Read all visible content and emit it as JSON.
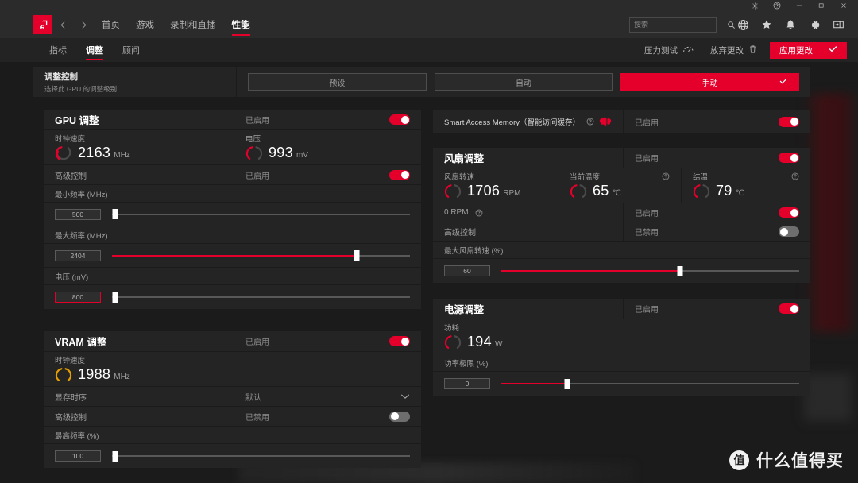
{
  "window": {
    "controls": [
      "settings-icon",
      "help-icon",
      "minimize-icon",
      "maximize-icon",
      "close-icon"
    ]
  },
  "nav": {
    "logo_alt": "AMD",
    "back": "←",
    "forward": "→",
    "items": [
      {
        "label": "首页",
        "active": false
      },
      {
        "label": "游戏",
        "active": false
      },
      {
        "label": "录制和直播",
        "active": false
      },
      {
        "label": "性能",
        "active": true
      }
    ],
    "search": {
      "value": "",
      "placeholder": "搜索"
    },
    "icons": [
      "globe-icon",
      "star-icon",
      "bell-icon",
      "gear-icon",
      "panel-icon"
    ]
  },
  "subnav": {
    "tabs": [
      {
        "label": "指标",
        "active": false
      },
      {
        "label": "调整",
        "active": true
      },
      {
        "label": "顾问",
        "active": false
      }
    ],
    "stress_test": "压力测试",
    "discard": "放弃更改",
    "apply": "应用更改"
  },
  "tuning_control": {
    "title": "调整控制",
    "subtitle": "选择此 GPU 的调整级别",
    "presets": [
      {
        "label": "预设",
        "selected": false
      },
      {
        "label": "自动",
        "selected": false
      },
      {
        "label": "手动",
        "selected": true
      }
    ]
  },
  "gpu_tuning": {
    "title": "GPU 调整",
    "enabled_label": "已启用",
    "enabled": true,
    "clock_speed": {
      "label": "时钟速度",
      "value": "2163",
      "unit": "MHz"
    },
    "voltage": {
      "label": "电压",
      "value": "993",
      "unit": "mV"
    },
    "advanced_control": {
      "label": "高级控制",
      "state": "已启用",
      "on": true
    },
    "min_freq": {
      "label": "最小频率 (MHz)",
      "value": "500",
      "percent": 1,
      "filled": 0,
      "alert": false
    },
    "max_freq": {
      "label": "最大频率 (MHz)",
      "value": "2404",
      "percent": 82,
      "filled": 82,
      "alert": false
    },
    "voltage_slider": {
      "label": "电压 (mV)",
      "value": "800",
      "percent": 1,
      "filled": 0,
      "alert": true
    }
  },
  "vram_tuning": {
    "title": "VRAM 调整",
    "enabled_label": "已启用",
    "enabled": true,
    "clock_speed": {
      "label": "时钟速度",
      "value": "1988",
      "unit": "MHz"
    },
    "memory_timing": {
      "label": "显存时序",
      "value": "默认"
    },
    "advanced_control": {
      "label": "高级控制",
      "state": "已禁用",
      "on": false
    },
    "max_freq": {
      "label": "最高频率 (%)",
      "value": "100",
      "percent": 1,
      "filled": 0
    }
  },
  "smart_access_memory": {
    "label": "Smart Access Memory（智能访问缓存）",
    "enabled_label": "已启用",
    "enabled": true
  },
  "fan_tuning": {
    "title": "风扇调整",
    "enabled_label": "已启用",
    "enabled": true,
    "fan_speed": {
      "label": "风扇转速",
      "value": "1706",
      "unit": "RPM"
    },
    "current_temp": {
      "label": "当前温度",
      "value": "65",
      "unit": "℃"
    },
    "junction_temp": {
      "label": "结温",
      "value": "79",
      "unit": "℃"
    },
    "zero_rpm": {
      "label": "0 RPM",
      "state": "已启用",
      "on": true
    },
    "advanced_control": {
      "label": "高级控制",
      "state": "已禁用",
      "on": false
    },
    "max_fan_speed": {
      "label": "最大风扇转速 (%)",
      "value": "60",
      "percent": 60,
      "filled": 60
    }
  },
  "power_tuning": {
    "title": "电源调整",
    "enabled_label": "已启用",
    "enabled": true,
    "power_draw": {
      "label": "功耗",
      "value": "194",
      "unit": "W"
    },
    "power_limit": {
      "label": "功率极限 (%)",
      "value": "0",
      "percent": 22,
      "filled": 22
    }
  },
  "watermark": {
    "mark": "值",
    "text": "什么值得买"
  }
}
